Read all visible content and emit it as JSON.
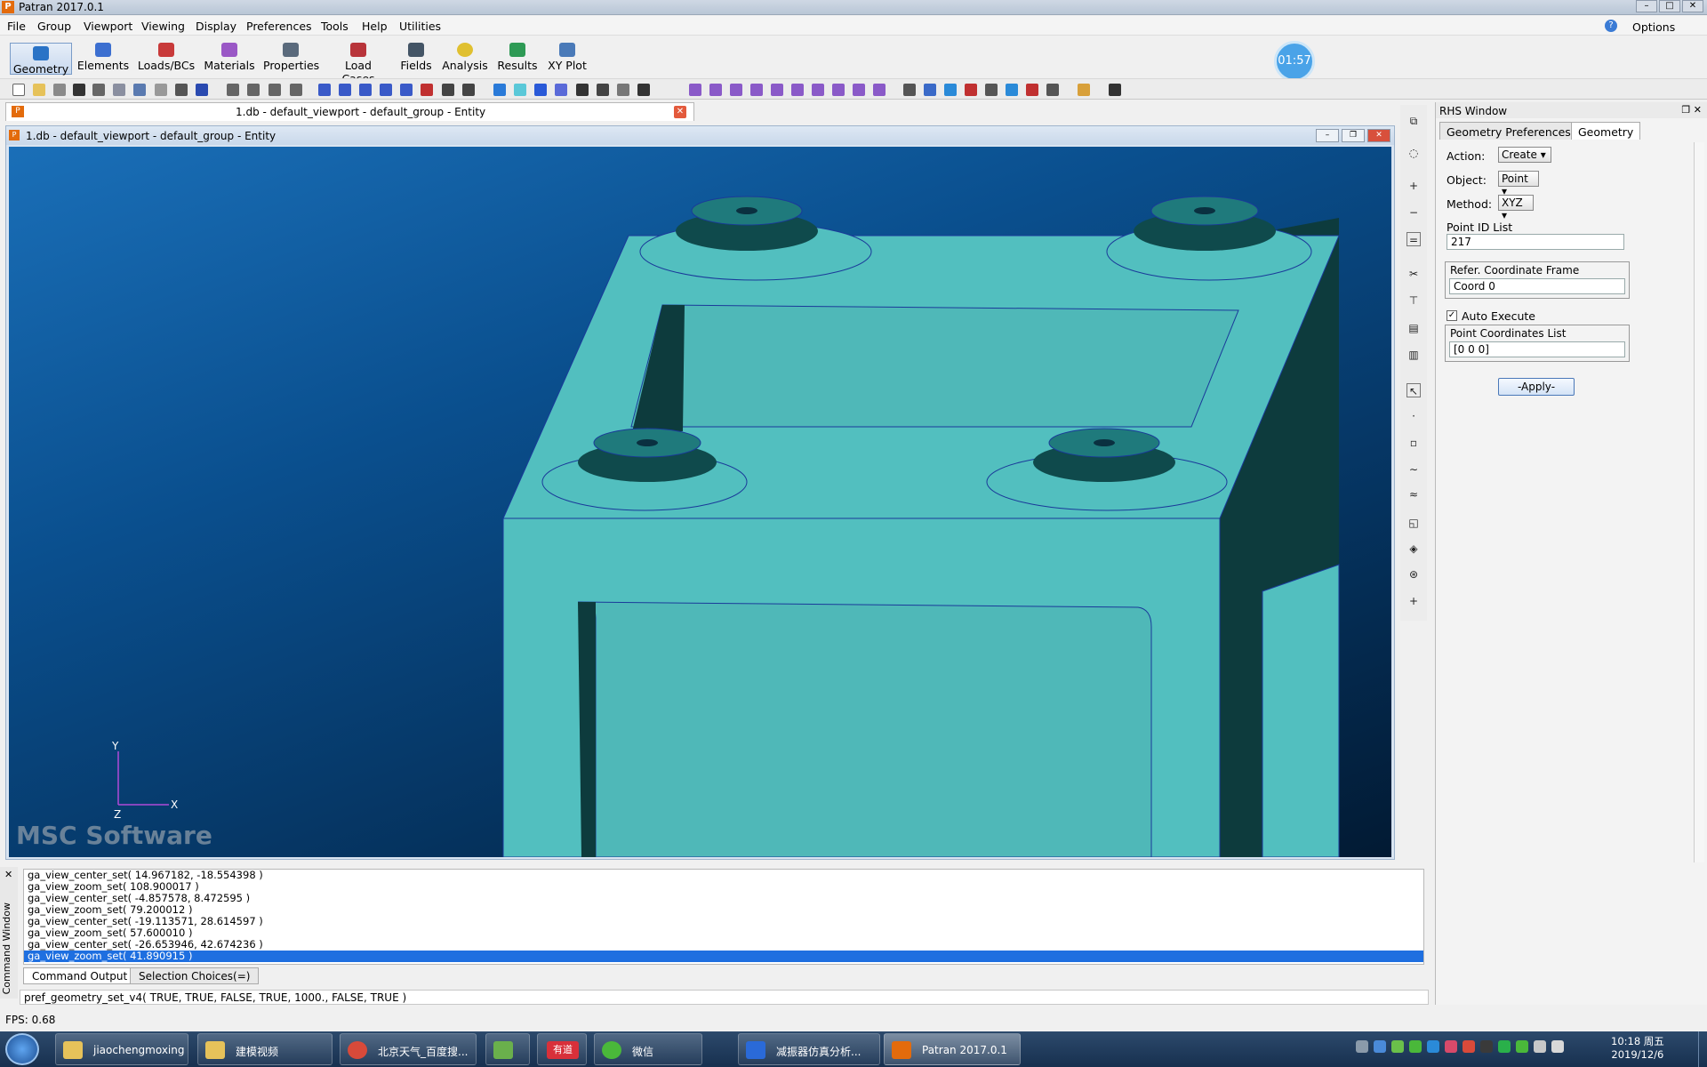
{
  "window": {
    "title": "Patran 2017.0.1",
    "app_icon_letter": "P"
  },
  "menu": {
    "items": [
      "File",
      "Group",
      "Viewport",
      "Viewing",
      "Display",
      "Preferences",
      "Tools",
      "Help",
      "Utilities"
    ],
    "options": "Options"
  },
  "appbar": {
    "buttons": [
      "Geometry",
      "Elements",
      "Loads/BCs",
      "Materials",
      "Properties",
      "Load Cases",
      "Fields",
      "Analysis",
      "Results",
      "XY Plot"
    ],
    "active": "Geometry"
  },
  "timer": "01:57",
  "doc_tab": {
    "title": "1.db - default_viewport - default_group - Entity"
  },
  "viewport": {
    "title": "1.db - default_viewport - default_group - Entity",
    "axis_x": "X",
    "axis_y": "Y",
    "axis_z": "Z",
    "logo": "MSC Software"
  },
  "rhs": {
    "title": "RHS Window",
    "tabs": [
      "Geometry Preferences",
      "Geometry"
    ],
    "selected_tab": "Geometry",
    "action_label": "Action:",
    "action_value": "Create",
    "object_label": "Object:",
    "object_value": "Point",
    "method_label": "Method:",
    "method_value": "XYZ",
    "point_id_label": "Point ID List",
    "point_id_value": "217",
    "coord_frame_label": "Refer. Coordinate Frame",
    "coord_frame_value": "Coord 0",
    "auto_execute_label": "Auto Execute",
    "auto_execute_checked": true,
    "coords_label": "Point Coordinates List",
    "coords_value": "[0 0 0]",
    "apply_label": "-Apply-"
  },
  "command_window": {
    "side_label": "Command Window",
    "log": [
      "ga_view_center_set( 14.967182, -18.554398 )",
      "ga_view_zoom_set( 108.900017 )",
      "ga_view_center_set( -4.857578, 8.472595 )",
      "ga_view_zoom_set( 79.200012 )",
      "ga_view_center_set( -19.113571, 28.614597 )",
      "ga_view_zoom_set( 57.600010 )",
      "ga_view_center_set( -26.653946, 42.674236 )",
      "ga_view_zoom_set( 41.890915 )"
    ],
    "selected_index": 7,
    "tabs": [
      "Command Output",
      "Selection Choices(=)"
    ],
    "input": "pref_geometry_set_v4( TRUE, TRUE, FALSE, TRUE, 1000., FALSE, TRUE )"
  },
  "status": {
    "fps": "FPS: 0.68"
  },
  "taskbar": {
    "items": [
      "jiaochengmoxing",
      "建模视频",
      "北京天气_百度搜...",
      "",
      "有道",
      "微信",
      "减振器仿真分析...",
      "Patran 2017.0.1"
    ],
    "active": "Patran 2017.0.1",
    "time": "10:18 周五",
    "date": "2019/12/6"
  },
  "colors": {
    "accent": "#1e6fe0",
    "model": "#52bfbf",
    "model_shadow": "#0d3b3d",
    "viewport_bg": "#0a4f8e"
  }
}
